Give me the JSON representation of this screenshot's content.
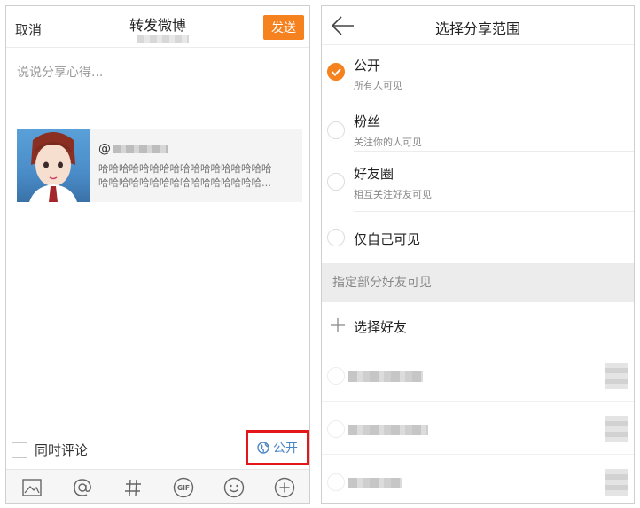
{
  "compose": {
    "cancel_label": "取消",
    "title": "转发微博",
    "send_label": "发送",
    "placeholder": "说说分享心得...",
    "quote": {
      "at_prefix": "@",
      "text_line1": "哈哈哈哈哈哈哈哈哈哈哈哈哈哈哈哈哈",
      "text_line2": "哈哈哈哈哈哈哈哈哈哈哈哈哈哈哈哈..."
    },
    "sync_comment_label": "同时评论",
    "scope_label": "公开",
    "toolbar_icons": [
      "image-icon",
      "mention-icon",
      "hashtag-icon",
      "gif-icon",
      "emoji-icon",
      "add-icon"
    ],
    "accent_color": "#f5821f",
    "highlight_color": "#e3161a"
  },
  "share_scope": {
    "title": "选择分享范围",
    "options": [
      {
        "label": "公开",
        "desc": "所有人可见",
        "checked": true
      },
      {
        "label": "粉丝",
        "desc": "关注你的人可见",
        "checked": false
      },
      {
        "label": "好友圈",
        "desc": "相互关注好友可见",
        "checked": false
      },
      {
        "label": "仅自己可见",
        "desc": "",
        "checked": false
      }
    ],
    "section_label": "指定部分好友可见",
    "pick_friends_label": "选择好友"
  }
}
